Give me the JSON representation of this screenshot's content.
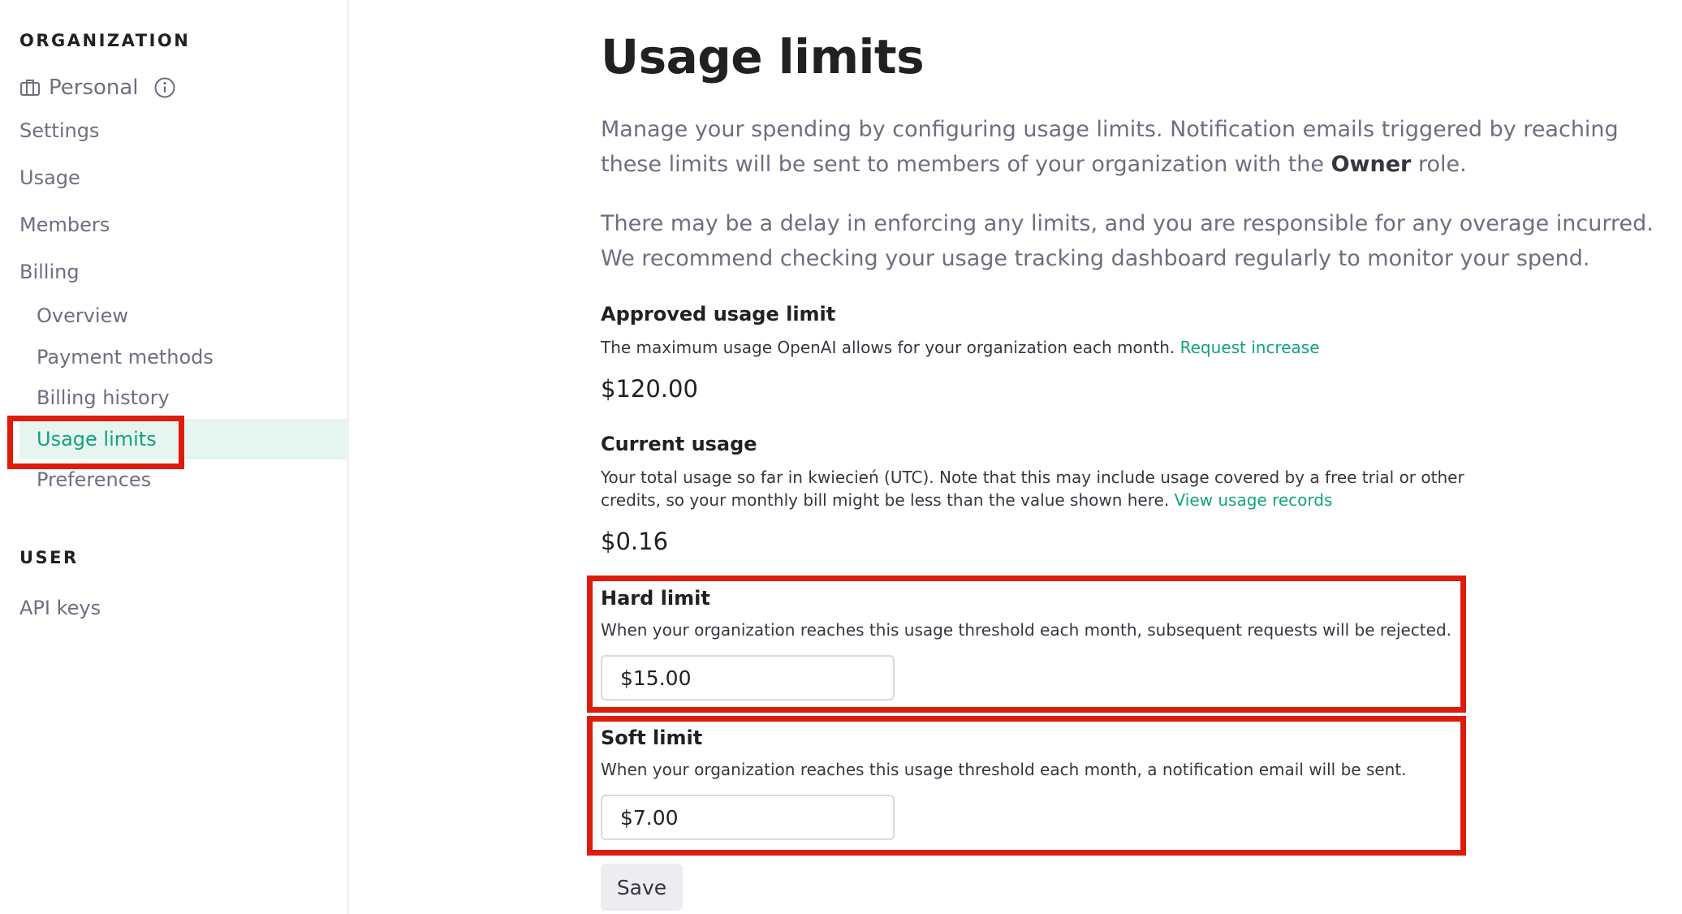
{
  "sidebar": {
    "org_header": "ORGANIZATION",
    "org_name": "Personal",
    "items": {
      "settings": "Settings",
      "usage": "Usage",
      "members": "Members",
      "billing": "Billing",
      "overview": "Overview",
      "payment_methods": "Payment methods",
      "billing_history": "Billing history",
      "usage_limits": "Usage limits",
      "preferences": "Preferences"
    },
    "user_header": "USER",
    "api_keys": "API keys",
    "active_item": "Usage limits"
  },
  "main": {
    "title": "Usage limits",
    "intro1_before": "Manage your spending by configuring usage limits. Notification emails triggered by reaching these limits will be sent to members of your organization with the ",
    "intro1_bold": "Owner",
    "intro1_after": " role.",
    "intro2": "There may be a delay in enforcing any limits, and you are responsible for any overage incurred. We recommend checking your usage tracking dashboard regularly to monitor your spend.",
    "approved": {
      "title": "Approved usage limit",
      "desc": "The maximum usage OpenAI allows for your organization each month. ",
      "link": "Request increase",
      "amount": "$120.00"
    },
    "current": {
      "title": "Current usage",
      "desc": "Your total usage so far in kwiecień (UTC). Note that this may include usage covered by a free trial or other credits, so your monthly bill might be less than the value shown here. ",
      "link": "View usage records",
      "amount": "$0.16"
    },
    "hard": {
      "title": "Hard limit",
      "desc": "When your organization reaches this usage threshold each month, subsequent requests will be rejected.",
      "value": "$15.00"
    },
    "soft": {
      "title": "Soft limit",
      "desc": "When your organization reaches this usage threshold each month, a notification email will be sent.",
      "value": "$7.00"
    },
    "save_label": "Save"
  },
  "colors": {
    "accent": "#10a37f",
    "annotation": "#dd1c0c",
    "active_bg": "#e7f5f1"
  },
  "icons": {
    "org": "briefcase-icon",
    "info": "info-icon"
  }
}
